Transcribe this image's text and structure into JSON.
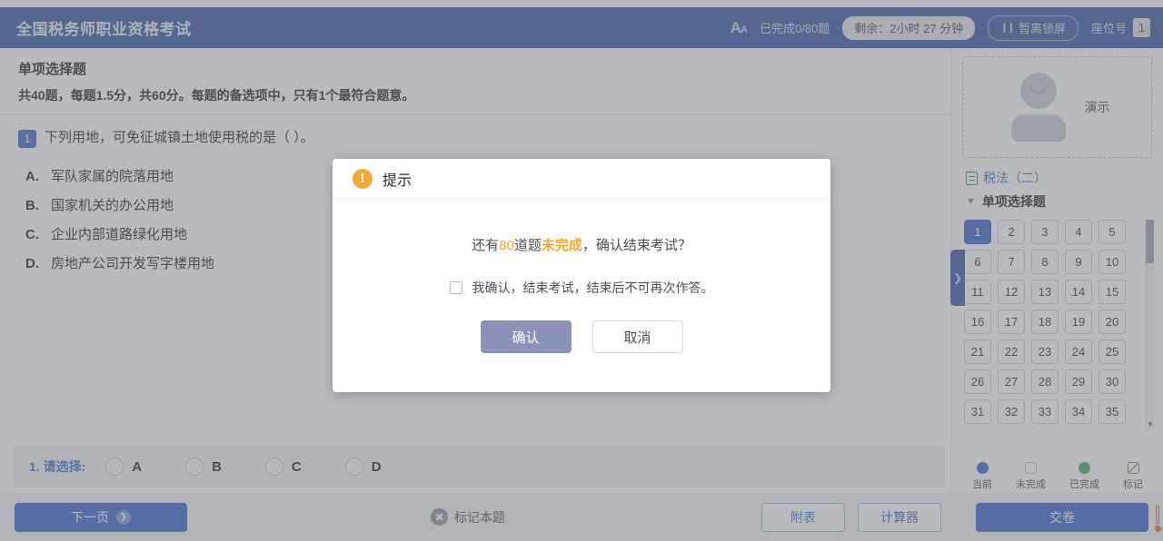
{
  "header": {
    "title": "全国税务师职业资格考试",
    "font_icon": "font-size-icon",
    "done_count": "已完成0/80题",
    "timer": "剩余：2小时 27 分钟",
    "lock_button": "暂离锁屏",
    "seat_label": "座位号",
    "seat_number": "1",
    "bg_color": "#2f51a0"
  },
  "question": {
    "section_title": "单项选择题",
    "section_desc": "共40题，每题1.5分，共60分。每题的备选项中，只有1个最符合题意。",
    "number": "1",
    "stem": "下列用地，可免征城镇土地使用税的是（        ）。",
    "options": [
      {
        "key": "A.",
        "text": "军队家属的院落用地"
      },
      {
        "key": "B.",
        "text": "国家机关的办公用地"
      },
      {
        "key": "C.",
        "text": "企业内部道路绿化用地"
      },
      {
        "key": "D.",
        "text": "房地产公司开发写字楼用地"
      }
    ]
  },
  "answer_bar": {
    "label": "1. 请选择:",
    "choices": [
      "A",
      "B",
      "C",
      "D"
    ]
  },
  "sidebar": {
    "avatar_name": "演示",
    "subject": "税法（二）",
    "group": "单项选择题",
    "numbers": [
      "1",
      "2",
      "3",
      "4",
      "5",
      "6",
      "7",
      "8",
      "9",
      "10",
      "11",
      "12",
      "13",
      "14",
      "15",
      "16",
      "17",
      "18",
      "19",
      "20",
      "21",
      "22",
      "23",
      "24",
      "25",
      "26",
      "27",
      "28",
      "29",
      "30",
      "31",
      "32",
      "33",
      "34",
      "35"
    ],
    "current_number": "1",
    "legend": [
      {
        "label": "当前",
        "state": "current",
        "color": "#2f5fc4"
      },
      {
        "label": "未完成",
        "state": "undone",
        "color": "#ffffff"
      },
      {
        "label": "已完成",
        "state": "done",
        "color": "#35a85b"
      },
      {
        "label": "标记",
        "state": "marked",
        "color": "#d94b4b"
      }
    ]
  },
  "toolbar": {
    "next_label": "下一页",
    "mark_label": "标记本题",
    "attachment_label": "附表",
    "calculator_label": "计算器",
    "submit_label": "交卷"
  },
  "modal": {
    "title": "提示",
    "msg_prefix": "还有",
    "msg_count": "80",
    "msg_middle": "道题",
    "msg_status": "未完成",
    "msg_suffix": "，确认结束考试？",
    "checkbox_label": "我确认，结束考试，结束后不可再次作答。",
    "confirm_label": "确认",
    "cancel_label": "取消",
    "accent_color": "#f5a623"
  }
}
